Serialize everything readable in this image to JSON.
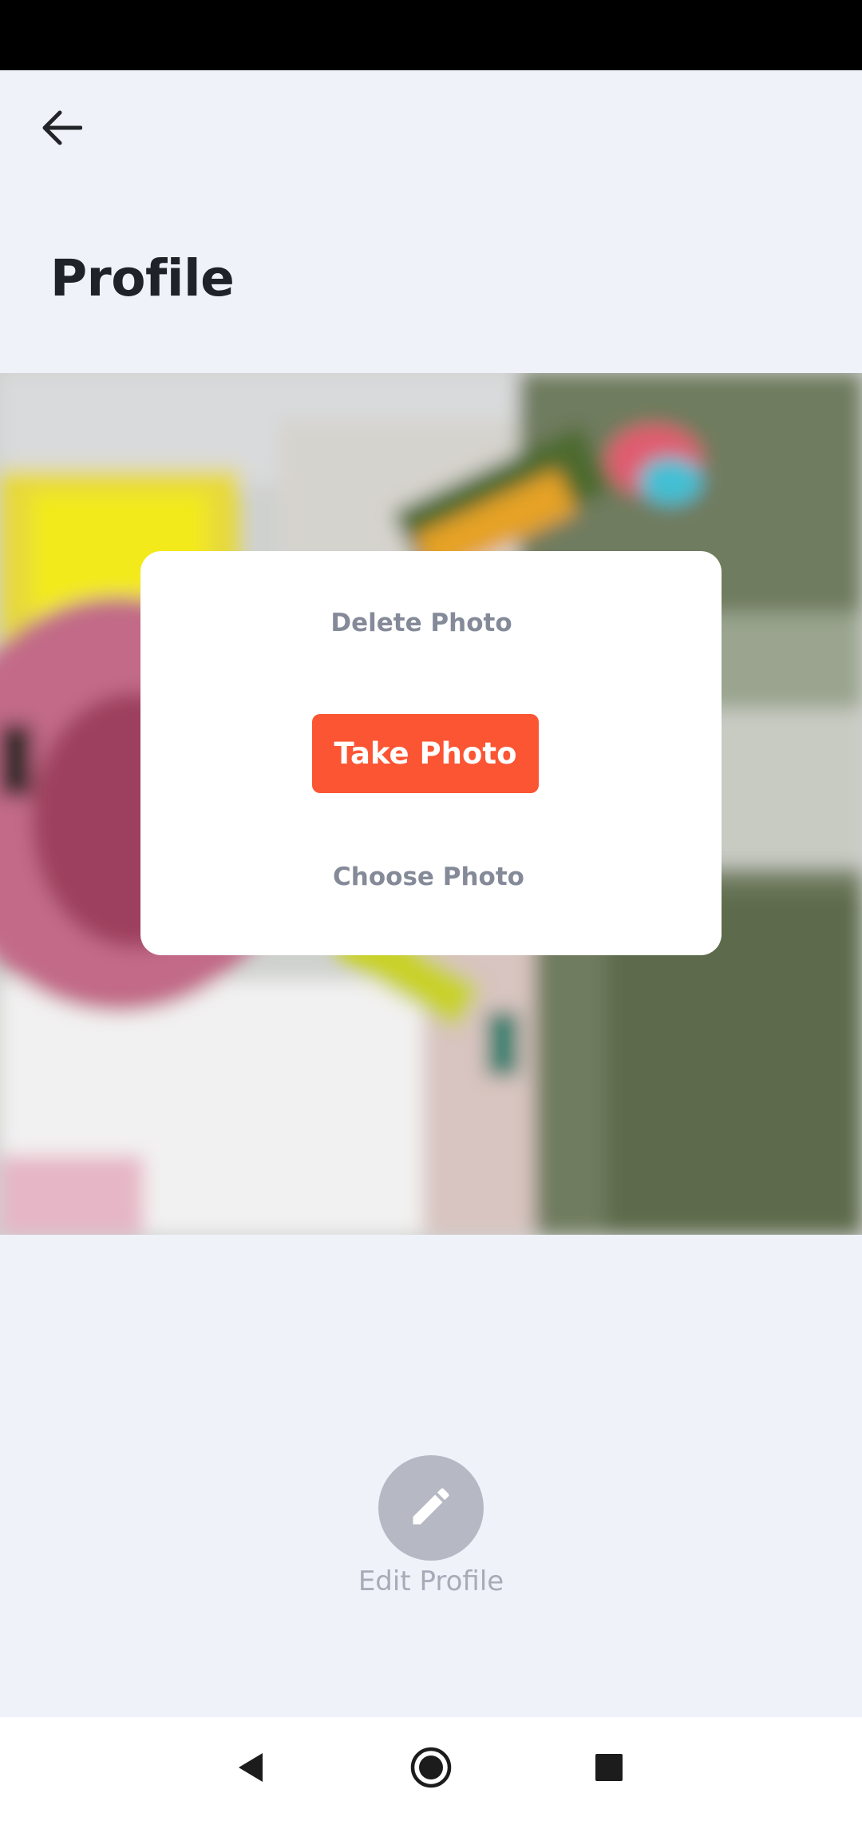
{
  "header": {
    "title": "Profile",
    "back_icon": "arrow-left-icon"
  },
  "photo_dialog": {
    "delete_label": "Delete Photo",
    "take_label": "Take Photo",
    "choose_label": "Choose Photo"
  },
  "edit_profile": {
    "label": "Edit Profile",
    "icon": "pencil-icon"
  },
  "nav_bar": {
    "back_icon": "nav-back-icon",
    "home_icon": "nav-home-icon",
    "recents_icon": "nav-recents-icon"
  },
  "colors": {
    "accent": "#fb5533",
    "background": "#eff2f9",
    "muted_text": "#858a99"
  }
}
